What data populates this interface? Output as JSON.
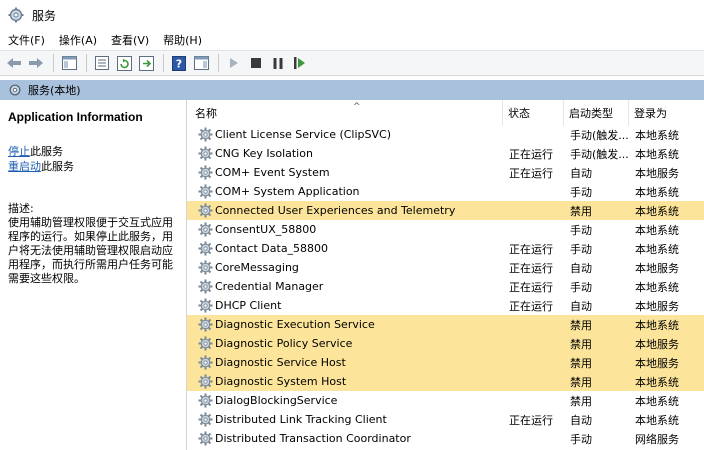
{
  "window": {
    "title": "服务"
  },
  "menu": [
    "文件(F)",
    "操作(A)",
    "查看(V)",
    "帮助(H)"
  ],
  "tree": {
    "label": "服务(本地)"
  },
  "left_pane": {
    "title": "Application Information",
    "stop_link": "停止",
    "stop_suffix": "此服务",
    "restart_link": "重启动",
    "restart_suffix": "此服务",
    "desc_label": "描述:",
    "desc_text": "使用辅助管理权限便于交互式应用程序的运行。如果停止此服务，用户将无法使用辅助管理权限启动应用程序，而执行所需用户任务可能需要这些权限。"
  },
  "columns": {
    "name": "名称",
    "status": "状态",
    "startup": "启动类型",
    "logon": "登录为"
  },
  "rows": [
    {
      "name": "Client License Service (ClipSVC)",
      "status": "",
      "startup": "手动(触发...",
      "logon": "本地系统",
      "highlight": false
    },
    {
      "name": "CNG Key Isolation",
      "status": "正在运行",
      "startup": "手动(触发...",
      "logon": "本地系统",
      "highlight": false
    },
    {
      "name": "COM+ Event System",
      "status": "正在运行",
      "startup": "自动",
      "logon": "本地服务",
      "highlight": false
    },
    {
      "name": "COM+ System Application",
      "status": "",
      "startup": "手动",
      "logon": "本地系统",
      "highlight": false
    },
    {
      "name": "Connected User Experiences and Telemetry",
      "status": "",
      "startup": "禁用",
      "logon": "本地系统",
      "highlight": true
    },
    {
      "name": "ConsentUX_58800",
      "status": "",
      "startup": "手动",
      "logon": "本地系统",
      "highlight": false
    },
    {
      "name": "Contact Data_58800",
      "status": "正在运行",
      "startup": "手动",
      "logon": "本地系统",
      "highlight": false
    },
    {
      "name": "CoreMessaging",
      "status": "正在运行",
      "startup": "自动",
      "logon": "本地服务",
      "highlight": false
    },
    {
      "name": "Credential Manager",
      "status": "正在运行",
      "startup": "手动",
      "logon": "本地系统",
      "highlight": false
    },
    {
      "name": "DHCP Client",
      "status": "正在运行",
      "startup": "自动",
      "logon": "本地服务",
      "highlight": false
    },
    {
      "name": "Diagnostic Execution Service",
      "status": "",
      "startup": "禁用",
      "logon": "本地系统",
      "highlight": true
    },
    {
      "name": "Diagnostic Policy Service",
      "status": "",
      "startup": "禁用",
      "logon": "本地服务",
      "highlight": true
    },
    {
      "name": "Diagnostic Service Host",
      "status": "",
      "startup": "禁用",
      "logon": "本地服务",
      "highlight": true
    },
    {
      "name": "Diagnostic System Host",
      "status": "",
      "startup": "禁用",
      "logon": "本地系统",
      "highlight": true
    },
    {
      "name": "DialogBlockingService",
      "status": "",
      "startup": "禁用",
      "logon": "本地系统",
      "highlight": false
    },
    {
      "name": "Distributed Link Tracking Client",
      "status": "正在运行",
      "startup": "自动",
      "logon": "本地系统",
      "highlight": false
    },
    {
      "name": "Distributed Transaction Coordinator",
      "status": "",
      "startup": "手动",
      "logon": "网络服务",
      "highlight": false
    }
  ],
  "colors": {
    "highlight": "#fce59a",
    "tree_header": "#a9c1dc",
    "link": "#1f5fb3"
  }
}
